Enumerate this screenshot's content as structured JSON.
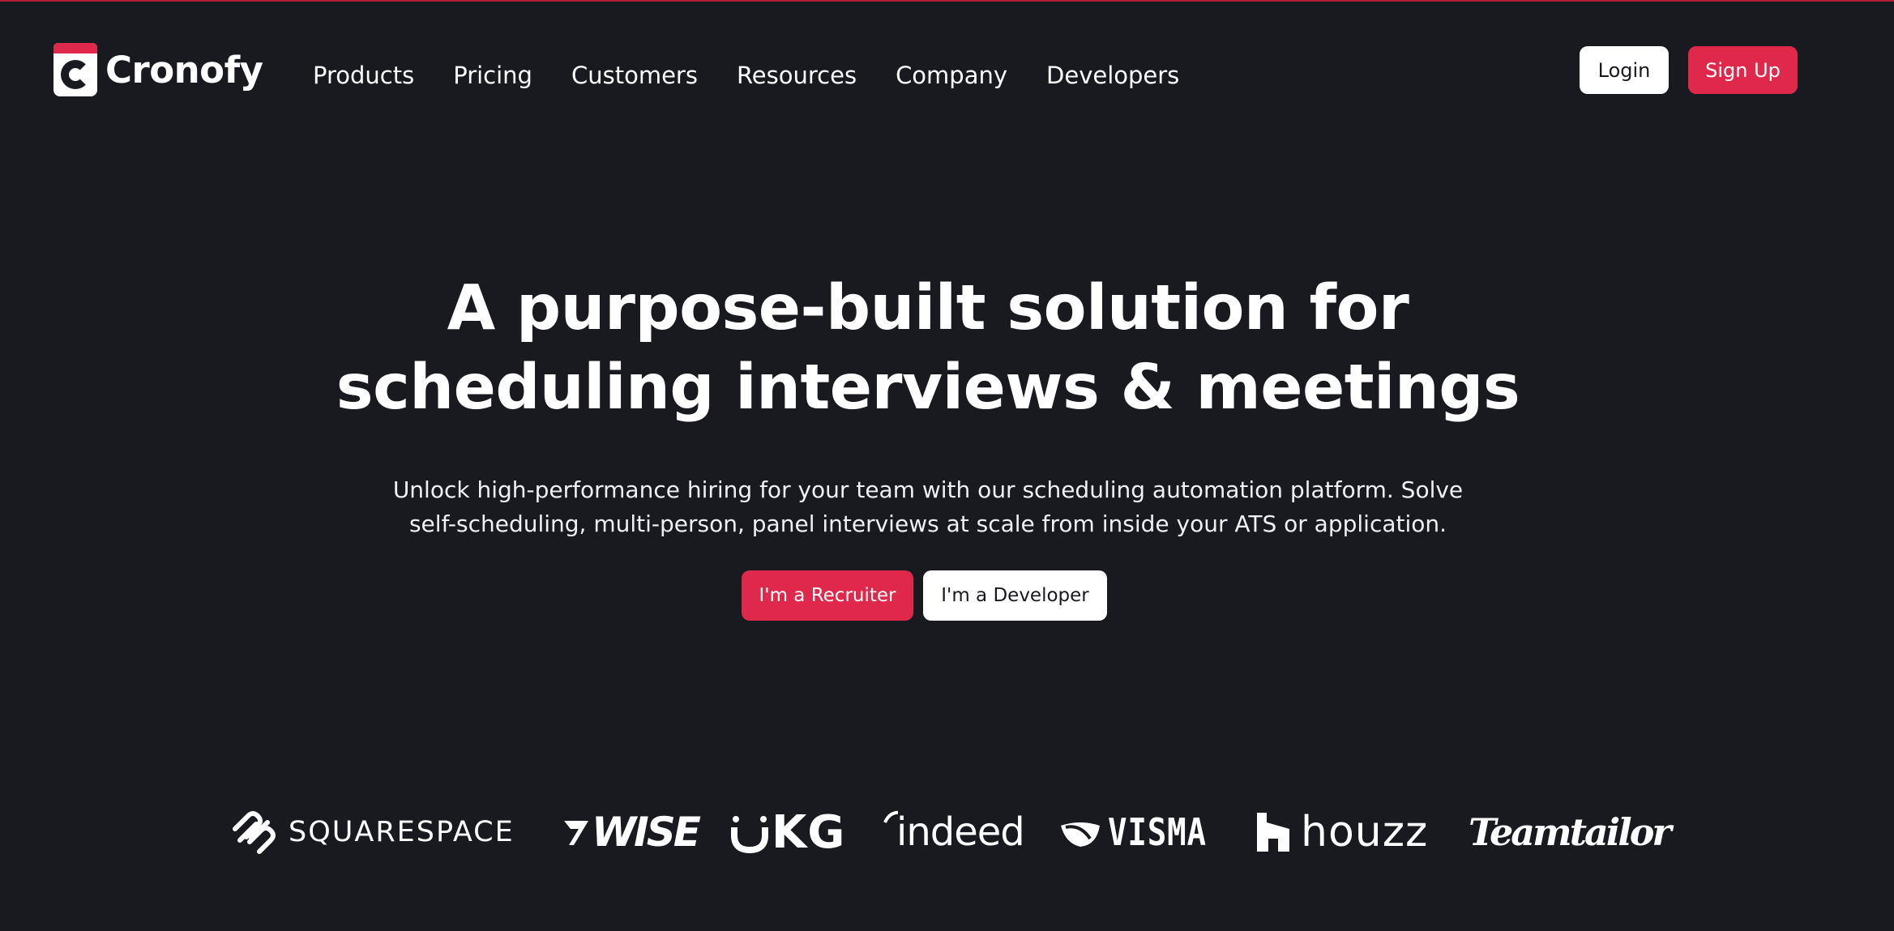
{
  "brand": {
    "name": "Cronofy"
  },
  "nav": {
    "items": [
      {
        "label": "Products"
      },
      {
        "label": "Pricing"
      },
      {
        "label": "Customers"
      },
      {
        "label": "Resources"
      },
      {
        "label": "Company"
      },
      {
        "label": "Developers"
      }
    ],
    "login_label": "Login",
    "signup_label": "Sign Up"
  },
  "hero": {
    "title_line1": "A purpose-built solution for",
    "title_line2": "scheduling interviews & meetings",
    "subtitle_line1": "Unlock high-performance hiring for your team with our scheduling automation platform. Solve",
    "subtitle_line2": "self-scheduling, multi-person, panel interviews at scale from inside your ATS or application.",
    "cta_recruiter": "I'm a Recruiter",
    "cta_developer": "I'm a Developer"
  },
  "logos": [
    {
      "name": "SQUARESPACE",
      "icon": "squarespace-logo-icon"
    },
    {
      "name": "WISE",
      "icon": "wise-logo-icon"
    },
    {
      "name": "KG",
      "icon": "ukg-logo-icon"
    },
    {
      "name": "indeed",
      "icon": "indeed-logo-icon"
    },
    {
      "name": "VISMA",
      "icon": "visma-logo-icon"
    },
    {
      "name": "houzz",
      "icon": "houzz-logo-icon"
    },
    {
      "name": "Teamtailor",
      "icon": "teamtailor-logo-icon"
    }
  ],
  "colors": {
    "background": "#181a1f",
    "accent": "#e0294a",
    "text": "#ffffff"
  }
}
